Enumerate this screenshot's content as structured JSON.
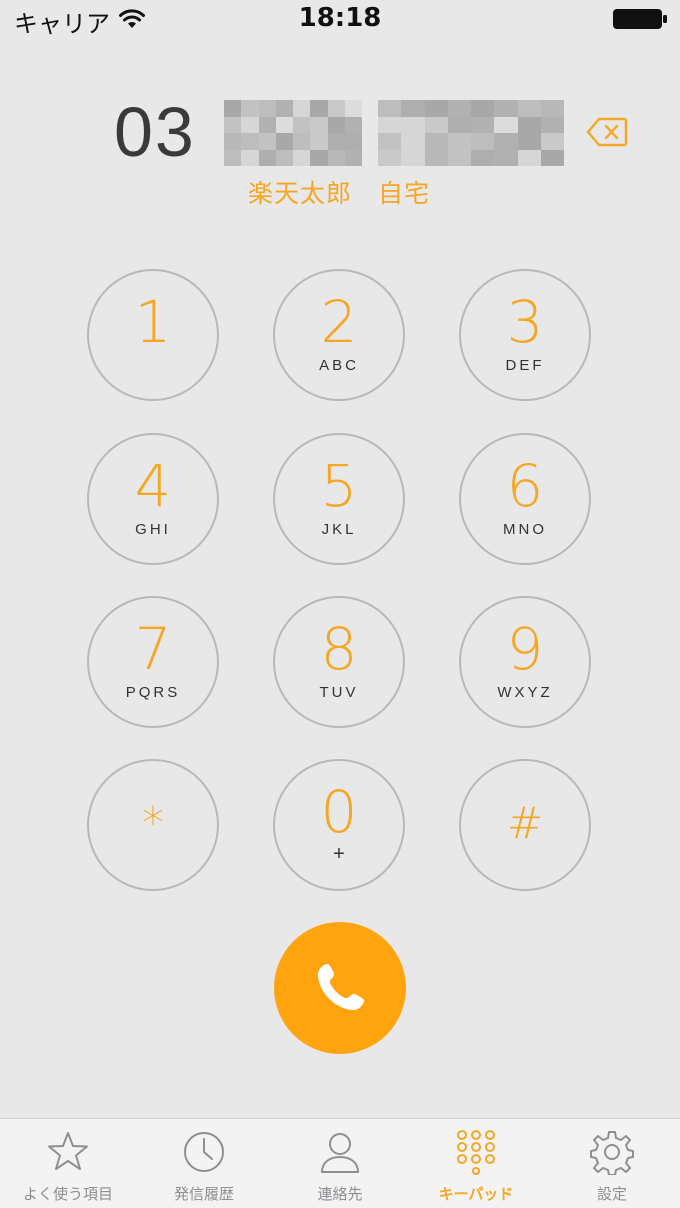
{
  "status_bar": {
    "carrier": "キャリア",
    "time": "18:18",
    "wifi_icon": "wifi-icon",
    "battery_icon": "battery-full-icon"
  },
  "number_display": {
    "prefix": "03",
    "masked_segments": [
      "masked-digits-1",
      "masked-digits-2"
    ],
    "contact_label": "楽天太郎　自宅",
    "delete_icon": "delete-backspace-icon"
  },
  "keypad": {
    "accent_color": "#f5a623",
    "keys": [
      {
        "digit": "1",
        "letters": ""
      },
      {
        "digit": "2",
        "letters": "ABC"
      },
      {
        "digit": "3",
        "letters": "DEF"
      },
      {
        "digit": "4",
        "letters": "GHI"
      },
      {
        "digit": "5",
        "letters": "JKL"
      },
      {
        "digit": "6",
        "letters": "MNO"
      },
      {
        "digit": "7",
        "letters": "PQRS"
      },
      {
        "digit": "8",
        "letters": "TUV"
      },
      {
        "digit": "9",
        "letters": "WXYZ"
      },
      {
        "digit": "*",
        "letters": ""
      },
      {
        "digit": "0",
        "letters": "+"
      },
      {
        "digit": "#",
        "letters": ""
      }
    ]
  },
  "call_button": {
    "icon": "phone-handset-icon",
    "color": "#ffa30f"
  },
  "tab_bar": {
    "tabs": [
      {
        "label": "よく使う項目",
        "icon": "star-icon",
        "active": false
      },
      {
        "label": "発信履歴",
        "icon": "clock-icon",
        "active": false
      },
      {
        "label": "連絡先",
        "icon": "person-icon",
        "active": false
      },
      {
        "label": "キーパッド",
        "icon": "keypad-grid-icon",
        "active": true
      },
      {
        "label": "設定",
        "icon": "gear-icon",
        "active": false
      }
    ],
    "active_color": "#f5a623",
    "inactive_color": "#8e8e93"
  }
}
